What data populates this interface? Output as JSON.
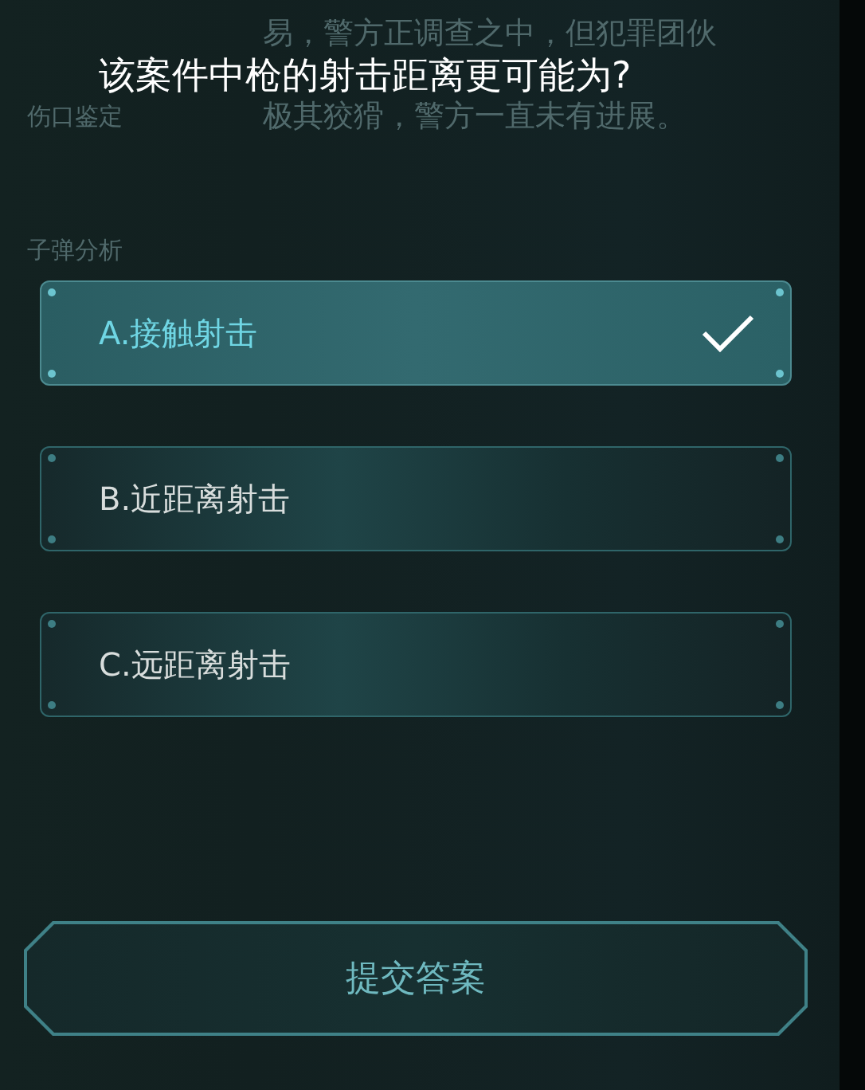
{
  "background": {
    "story_lines": [
      "易，警方正调查之中，但犯罪团伙",
      "极其狡猾，警方一直未有进展。"
    ],
    "sections": [
      "伤口鉴定",
      "子弹分析"
    ]
  },
  "question": "该案件中枪的射击距离更可能为?",
  "options": [
    {
      "label": "A.接触射击",
      "selected": true
    },
    {
      "label": "B.近距离射击",
      "selected": false
    },
    {
      "label": "C.远距离射击",
      "selected": false
    }
  ],
  "submit_button": "提交答案"
}
